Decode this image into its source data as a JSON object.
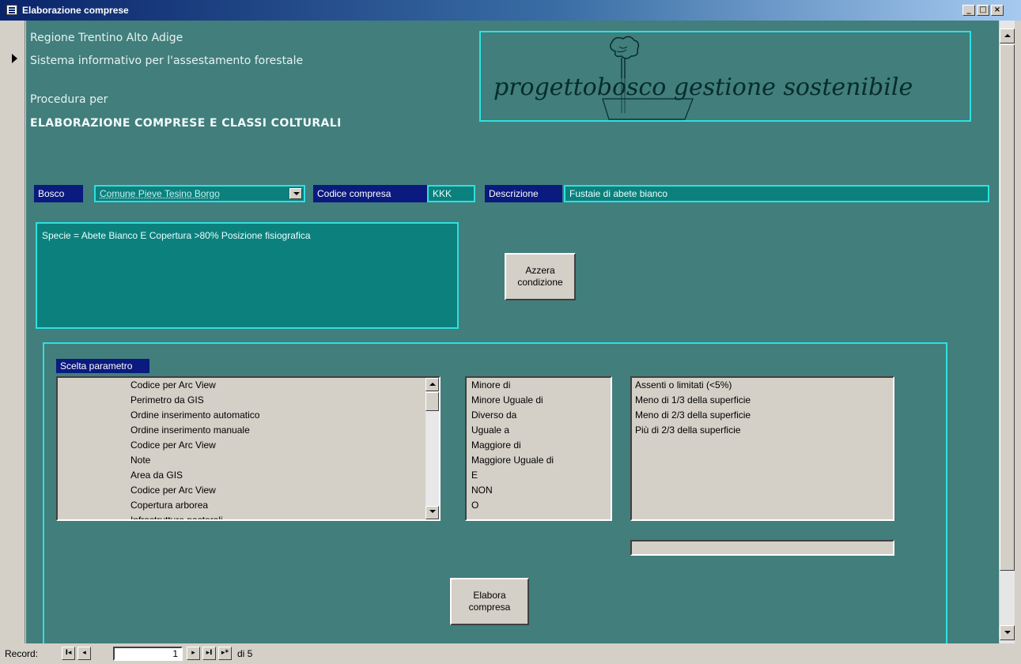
{
  "window": {
    "title": "Elaborazione comprese",
    "controls": {
      "minimize": "_",
      "maximize": "□",
      "close": "×"
    }
  },
  "header": {
    "line1": "Regione  Trentino Alto Adige",
    "line2": "Sistema informativo per l'assestamento forestale",
    "line3": "Procedura per",
    "line4": "ELABORAZIONE COMPRESE E CLASSI COLTURALI"
  },
  "logo": {
    "text": "progettobosco gestione sostenibile",
    "icon": "tree-logo-icon"
  },
  "fields": {
    "bosco_label": "Bosco",
    "bosco_value": "Comune Pieve Tesino Borgo",
    "codice_label": "Codice compresa",
    "codice_value": "KKK",
    "descrizione_label": "Descrizione",
    "descrizione_value": "Fustaie di abete bianco"
  },
  "condition": {
    "text": "Specie = Abete Bianco E Copertura >80% Posizione fisiografica"
  },
  "buttons": {
    "azzera": [
      "Azzera",
      "condizione"
    ],
    "elabora": [
      "Elabora",
      "compresa"
    ]
  },
  "params": {
    "label": "Scelta parametro",
    "items": [
      "Codice per Arc View",
      "Perimetro da GIS",
      "Ordine inserimento automatico",
      "Ordine inserimento manuale",
      "Codice per Arc View",
      "Note",
      "Area da GIS",
      "Codice per Arc View",
      "Copertura arborea",
      "Infrastrutture pastorali"
    ]
  },
  "operators": [
    "Minore di",
    "Minore Uguale di",
    "Diverso da",
    "Uguale a",
    "Maggiore di",
    "Maggiore Uguale di",
    "E",
    "NON",
    "O"
  ],
  "values": [
    "Assenti o limitati (<5%)",
    "Meno di 1/3 della superficie",
    "Meno di 2/3 della superficie",
    "Più di 2/3 della superficie"
  ],
  "navigation": {
    "record_label": "Record:",
    "current": "1",
    "total": "di 5",
    "first": "I◂",
    "prev": "◂",
    "next": "▸",
    "last": "▸I",
    "new": "▸*"
  },
  "colors": {
    "form_background": "#417e7c",
    "accent_border": "#2ee0e0",
    "label_background": "#0a1a7e",
    "title_bar": "#0a246a"
  }
}
